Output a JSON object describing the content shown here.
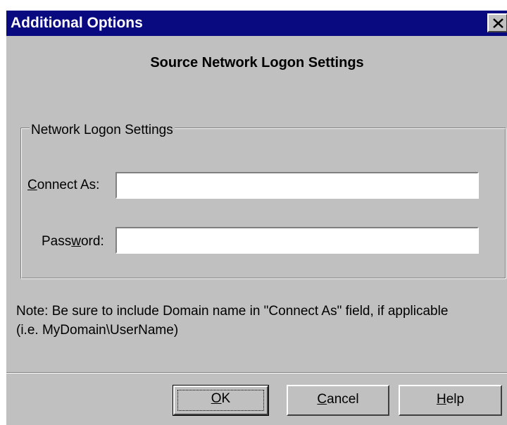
{
  "window": {
    "title": "Additional Options",
    "close_icon": "close-icon"
  },
  "heading": "Source Network Logon Settings",
  "group": {
    "legend": "Network Logon Settings",
    "connect_as": {
      "label_prefix": "",
      "label_mnemonic": "C",
      "label_rest": "onnect As:",
      "value": ""
    },
    "password": {
      "label_prefix": "Pass",
      "label_mnemonic": "w",
      "label_rest": "ord:",
      "value": ""
    }
  },
  "note": {
    "line1": "Note: Be sure to include Domain name in \"Connect As\" field, if applicable",
    "line2": "(i.e. MyDomain\\UserName)"
  },
  "buttons": {
    "ok": {
      "mnemonic": "O",
      "rest": "K"
    },
    "cancel": {
      "mnemonic": "C",
      "rest": "ancel"
    },
    "help": {
      "mnemonic": "H",
      "rest": "elp"
    }
  }
}
